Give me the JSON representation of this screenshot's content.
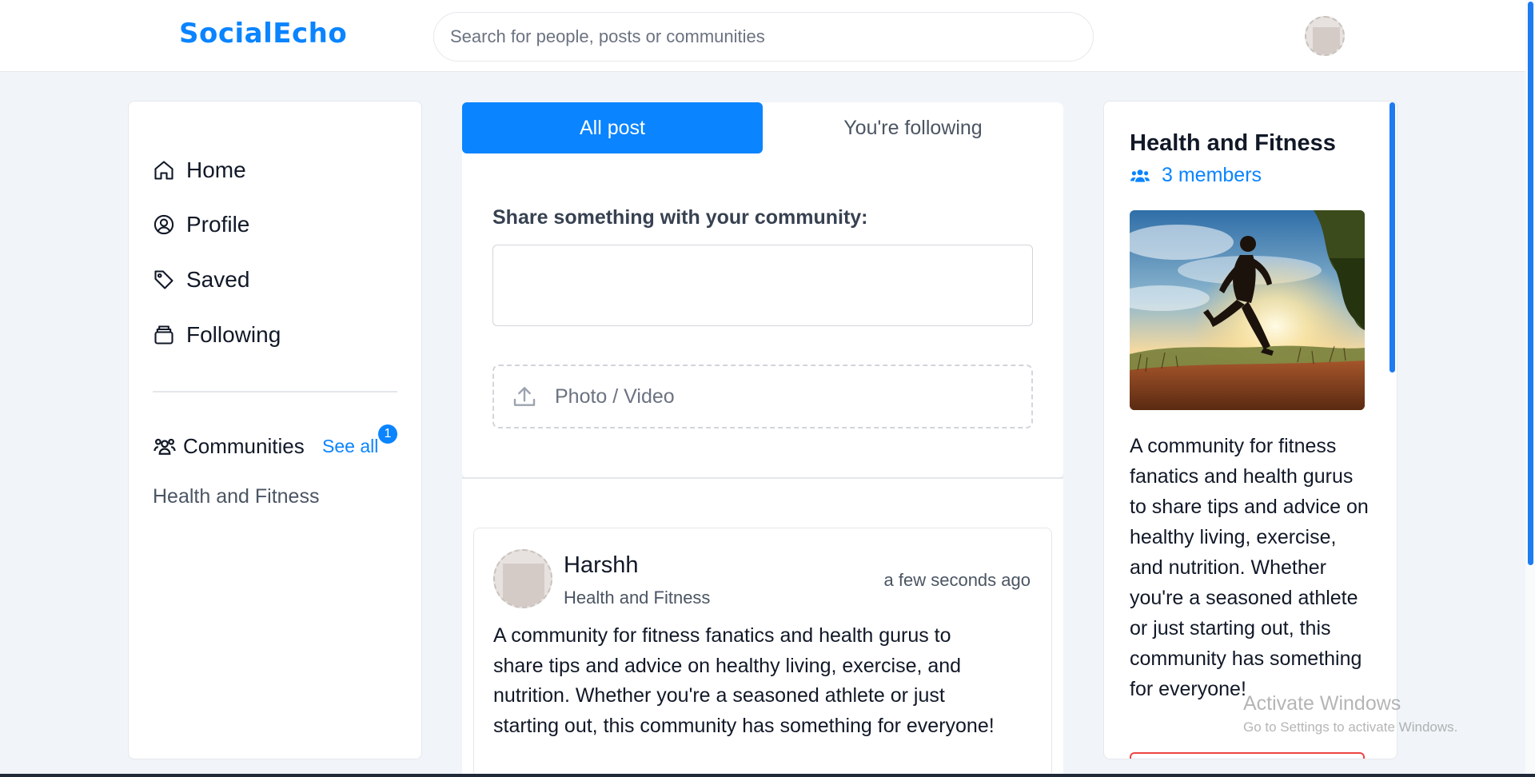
{
  "header": {
    "logo": "SocialEcho",
    "search_placeholder": "Search for people, posts or communities",
    "avatar_icon": "user-avatar"
  },
  "sidebar": {
    "items": [
      {
        "label": "Home",
        "icon": "home-icon"
      },
      {
        "label": "Profile",
        "icon": "profile-icon"
      },
      {
        "label": "Saved",
        "icon": "tag-icon"
      },
      {
        "label": "Following",
        "icon": "following-icon"
      }
    ],
    "communities_label": "Communities",
    "see_all": "See all",
    "badge_count": "1",
    "communities": [
      "Health and Fitness"
    ]
  },
  "feed": {
    "tabs": [
      {
        "label": "All post",
        "active": true
      },
      {
        "label": "You're following",
        "active": false
      }
    ],
    "share_label": "Share something with your community:",
    "share_value": "",
    "upload_label": "Photo / Video"
  },
  "post": {
    "author": "Harshh",
    "community": "Health and Fitness",
    "time": "a few seconds ago",
    "body": "A community for fitness fanatics and health gurus to share tips and advice on healthy living, exercise, and nutrition. Whether you're a seasoned athlete or just starting out, this community has something for everyone!"
  },
  "community_panel": {
    "title": "Health and Fitness",
    "members": "3 members",
    "image": "runner-at-sunset",
    "description": "A community for fitness fanatics and health gurus to share tips and advice on healthy living, exercise, and nutrition. Whether you're a seasoned athlete or just starting out, this community has something for everyone!"
  },
  "watermark": {
    "line1": "Activate Windows",
    "line2": "Go to Settings to activate Windows."
  },
  "colors": {
    "accent": "#0a84ff",
    "background": "#f1f5f9",
    "danger": "#ef4444"
  }
}
